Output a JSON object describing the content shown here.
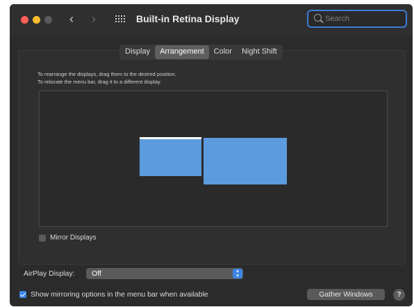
{
  "window": {
    "title": "Built-in Retina Display",
    "nav_back": "‹",
    "nav_forward": "›"
  },
  "search": {
    "placeholder": "Search",
    "value": ""
  },
  "tabs": [
    {
      "label": "Display",
      "active": false
    },
    {
      "label": "Arrangement",
      "active": true
    },
    {
      "label": "Color",
      "active": false
    },
    {
      "label": "Night Shift",
      "active": false
    }
  ],
  "arrangement": {
    "instruction_line1": "To rearrange the displays, drag them to the desired position.",
    "instruction_line2": "To relocate the menu bar, drag it to a different display."
  },
  "mirror_displays": {
    "label": "Mirror Displays",
    "checked": false
  },
  "airplay": {
    "label": "AirPlay Display:",
    "selected": "Off"
  },
  "menu_option": {
    "label": "Show mirroring options in the menu bar when available",
    "checked": true
  },
  "gather_windows_label": "Gather Windows",
  "help_label": "?",
  "icons": {
    "close": "close-icon",
    "minimize": "minimize-icon",
    "zoom": "zoom-icon",
    "grid": "grid-icon",
    "search": "search-icon",
    "stepper": "stepper-icon"
  },
  "colors": {
    "window_bg": "#2b2b2b",
    "accent": "#3c86e6",
    "display_blue": "#5b9bde",
    "traffic_red": "#fe5f57",
    "traffic_yellow": "#febc2e"
  }
}
